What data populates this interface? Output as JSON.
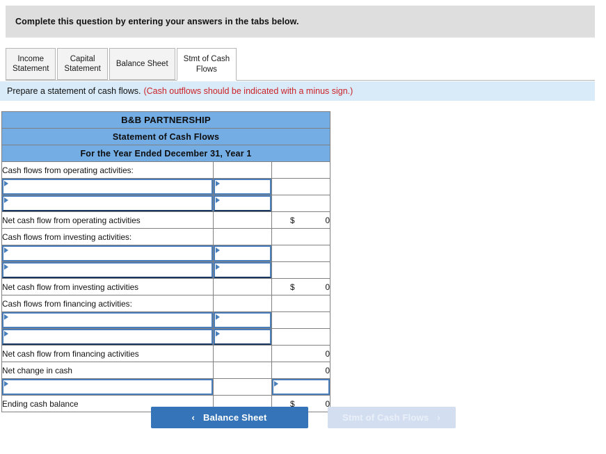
{
  "banner": {
    "text": "Complete this question by entering your answers in the tabs below."
  },
  "tabs": [
    {
      "label": "Income\nStatement",
      "active": false
    },
    {
      "label": "Capital\nStatement",
      "active": false
    },
    {
      "label": "Balance Sheet",
      "active": false
    },
    {
      "label": "Stmt of Cash\nFlows",
      "active": true
    }
  ],
  "instruction": {
    "main": "Prepare a statement of cash flows.",
    "note": "(Cash outflows should be indicated with a minus sign.)"
  },
  "statement": {
    "header": {
      "company": "B&B PARTNERSHIP",
      "title": "Statement of Cash Flows",
      "period": "For the Year Ended December 31, Year 1"
    },
    "rows": [
      {
        "label": "Cash flows from operating activities:",
        "type": "section"
      },
      {
        "type": "entry"
      },
      {
        "type": "entry",
        "closing": true
      },
      {
        "label": "Net cash flow from operating activities",
        "type": "total",
        "dollar": "$",
        "value": "0"
      },
      {
        "label": "Cash flows from investing activities:",
        "type": "section"
      },
      {
        "type": "entry"
      },
      {
        "type": "entry",
        "closing": true
      },
      {
        "label": "Net cash flow from investing activities",
        "type": "total",
        "dollar": "$",
        "value": "0"
      },
      {
        "label": "Cash flows from financing activities:",
        "type": "section"
      },
      {
        "type": "entry"
      },
      {
        "type": "entry",
        "closing": true
      },
      {
        "label": "Net cash flow from financing activities",
        "type": "total",
        "dollar": "",
        "value": "0"
      },
      {
        "label": "Net change in cash",
        "type": "total-underline",
        "dollar": "",
        "value": "0"
      },
      {
        "type": "entry-value"
      },
      {
        "label": "Ending cash balance",
        "type": "grand-total",
        "dollar": "$",
        "value": "0"
      }
    ]
  },
  "nav": {
    "prev_label": "Balance Sheet",
    "prev_chevron": "‹",
    "next_label": "Stmt of Cash Flows",
    "next_chevron": "›"
  },
  "colors": {
    "banner_bg": "#dedede",
    "instruction_bg": "#d9ebf8",
    "note_text": "#cc2128",
    "table_header_bg": "#74ace4",
    "input_border": "#4a7ebb",
    "prev_button_bg": "#3574b8",
    "next_button_bg": "#d3dff0"
  }
}
